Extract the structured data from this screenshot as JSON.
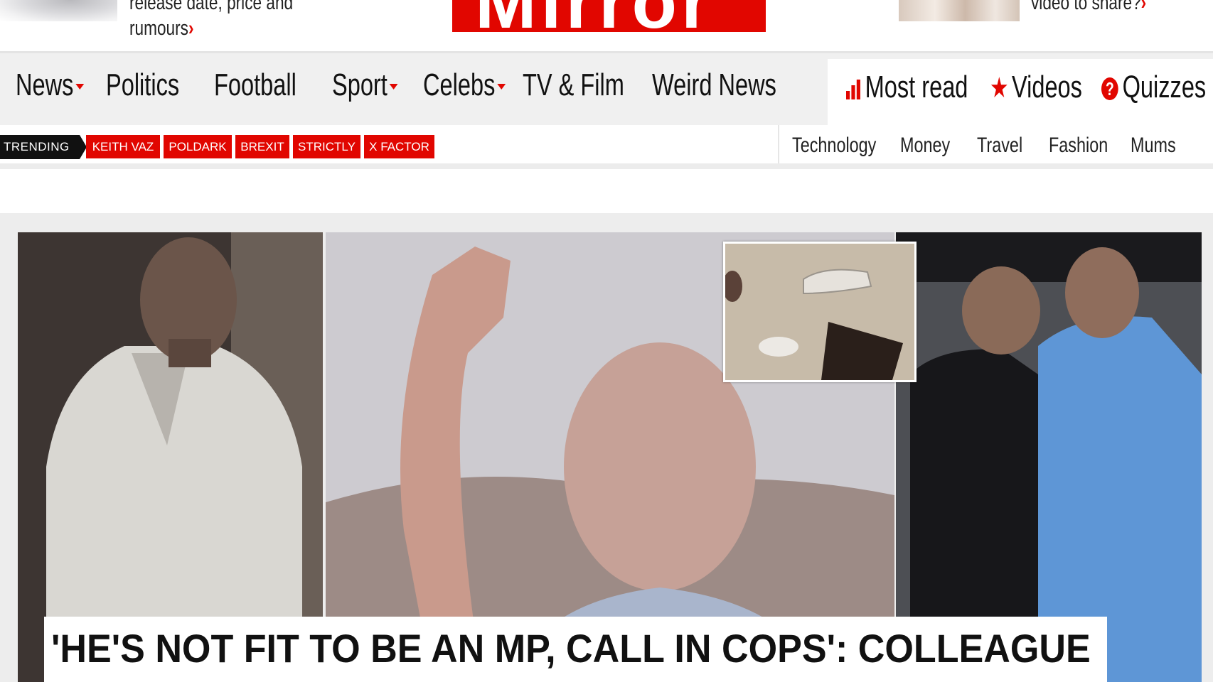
{
  "promo_left": {
    "text_line1": "release date, price and",
    "text_line2": "rumours",
    "chevron": "›"
  },
  "logo": {
    "text": "Mirror"
  },
  "promo_right": {
    "text": "video to share?",
    "chevron": "›"
  },
  "nav": {
    "items": [
      {
        "label": "News",
        "dropdown": true
      },
      {
        "label": "Politics",
        "dropdown": false
      },
      {
        "label": "Football",
        "dropdown": false
      },
      {
        "label": "Sport",
        "dropdown": true
      },
      {
        "label": "Celebs",
        "dropdown": true
      },
      {
        "label": "TV & Film",
        "dropdown": false
      },
      {
        "label": "Weird News",
        "dropdown": false
      }
    ],
    "right_items": [
      {
        "label": "Most read",
        "icon": "bar-chart-icon"
      },
      {
        "label": "Videos",
        "icon": "star-icon"
      },
      {
        "label": "Quizzes",
        "icon": "question-icon"
      }
    ]
  },
  "trending": {
    "label": "TRENDING",
    "tags": [
      "KEITH VAZ",
      "POLDARK",
      "BREXIT",
      "STRICTLY",
      "X FACTOR"
    ]
  },
  "sub_nav": [
    "Technology",
    "Money",
    "Travel",
    "Fashion",
    "Mums"
  ],
  "hero": {
    "headline": "'HE'S NOT FIT TO BE AN MP, CALL IN COPS': COLLEAGUE"
  },
  "colors": {
    "brand_red": "#e10600",
    "nav_bg": "#f0f0f0",
    "text": "#111111"
  }
}
